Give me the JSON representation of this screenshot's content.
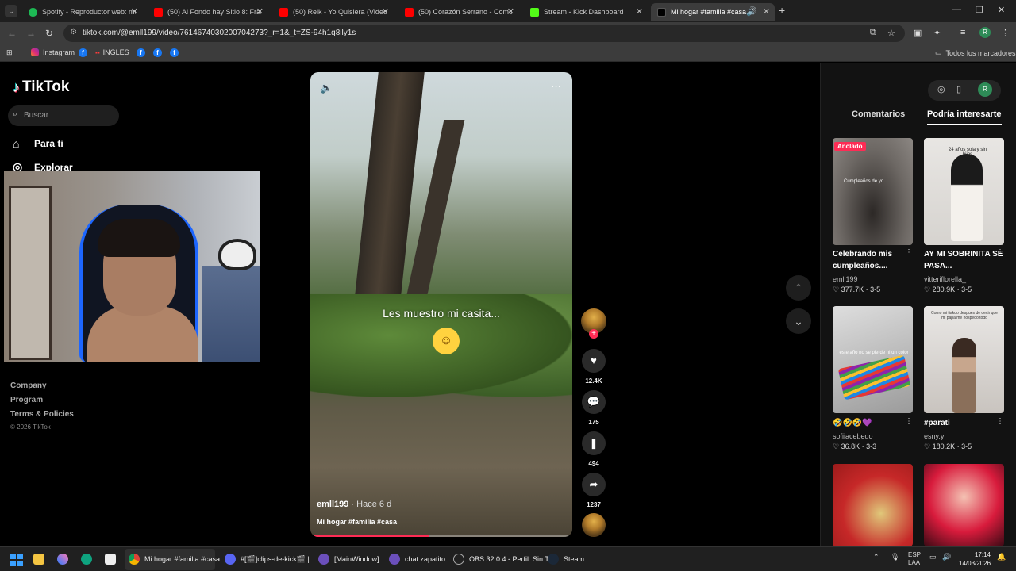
{
  "browser": {
    "tabs": [
      {
        "title": "Spotify - Reproductor web: mú",
        "color": "#1db954"
      },
      {
        "title": "(50) Al Fondo hay Sitio 8: Franc",
        "color": "#ff0000"
      },
      {
        "title": "(50) Reik - Yo Quisiera (Video)",
        "color": "#ff0000"
      },
      {
        "title": "(50) Corazón Serrano - Como S",
        "color": "#ff0000"
      },
      {
        "title": "Stream - Kick Dashboard",
        "color": "#53fc18"
      },
      {
        "title": "Mi hogar #familia #casa | Ti",
        "color": "#000000"
      }
    ],
    "url": "tiktok.com/@emll199/video/7614674030200704273?_r=1&_t=ZS-94h1q8ily1s",
    "profile_initial": "R",
    "bookmarks": {
      "instagram": "Instagram",
      "ingles": "INGLES",
      "all": "Todos los marcadores"
    }
  },
  "tiktok": {
    "logo": "TikTok",
    "search_placeholder": "Buscar",
    "nav": {
      "for_you": "Para ti",
      "explore": "Explorar"
    },
    "footer": {
      "company": "Company",
      "program": "Program",
      "terms": "Terms & Policies",
      "copyright": "© 2026 TikTok"
    },
    "video": {
      "caption": "Les muestro mi casita...",
      "author": "emll199",
      "ago": "· Hace 6 d",
      "description": "Mi hogar #familia #casa",
      "progress": 0.45
    },
    "actions": {
      "likes": "12.4K",
      "comments": "175",
      "saves": "494",
      "shares": "1237"
    },
    "panel": {
      "tab_comments": "Comentarios",
      "tab_suggested": "Podría interesarte",
      "pinned_badge": "Anclado",
      "items": [
        {
          "title": "Celebrando mis cumpleaños....",
          "user": "emll199",
          "views": "377.7K",
          "date": "3-5"
        },
        {
          "title": "AY MI SOBRINITA SE PASA...",
          "user": "vitteriflorella_",
          "views": "280.9K",
          "date": "3-5"
        },
        {
          "title": "🤣🤣🤣💜",
          "user": "sofiiacebedo",
          "views": "36.8K",
          "date": "3-3"
        },
        {
          "title": "#parati",
          "user": "esny.y",
          "views": "180.2K",
          "date": "3-5"
        }
      ],
      "thumb_texts": {
        "t1": "Cumpleaños de yo ...",
        "t2": "24 años sola y sin hijos",
        "t3": "este año no se pierde ni un color",
        "t4": "Como mi tiakdo despues de decir que mi papa me hospedo todo"
      }
    }
  },
  "taskbar": {
    "chrome": "Mi hogar #familia #casa",
    "discord": "#[🎬]clips-de-kick🎬 |",
    "mainwindow": "[MainWindow]",
    "chat": "chat zapatito",
    "obs": "OBS 32.0.4 - Perfil: Sin T",
    "steam": "Steam",
    "lang1": "ESP",
    "lang2": "LAA",
    "time": "17:14",
    "date": "14/03/2026"
  }
}
